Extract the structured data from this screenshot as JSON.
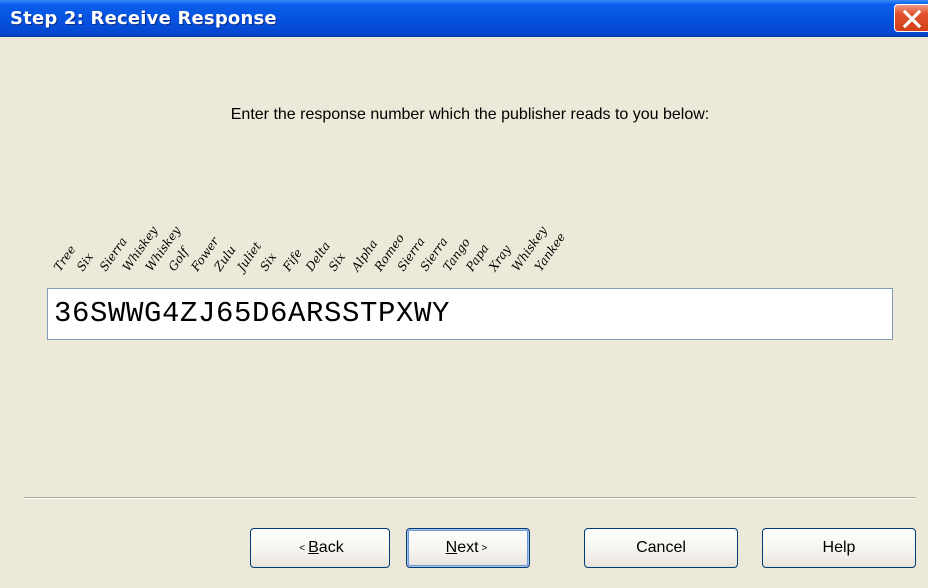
{
  "window": {
    "title": "Step 2: Receive Response",
    "close_icon": "close-icon"
  },
  "prompt": "Enter the response number which the publisher reads to you below:",
  "phonetic_words": [
    "Tree",
    "Six",
    "Sierra",
    "Whiskey",
    "Whiskey",
    "Golf",
    "Fower",
    "Zulu",
    "Juliet",
    "Six",
    "Fife",
    "Delta",
    "Six",
    "Alpha",
    "Romeo",
    "Sierra",
    "Sierra",
    "Tango",
    "Papa",
    "Xray",
    "Whiskey",
    "Yankee"
  ],
  "response": {
    "value": "36SWWG4ZJ65D6ARSSTPXWY"
  },
  "buttons": {
    "back": {
      "arrow": "<",
      "mnemonic": "B",
      "rest": "ack"
    },
    "next": {
      "mnemonic": "N",
      "rest": "ext",
      "arrow": ">"
    },
    "cancel": "Cancel",
    "help": "Help"
  }
}
